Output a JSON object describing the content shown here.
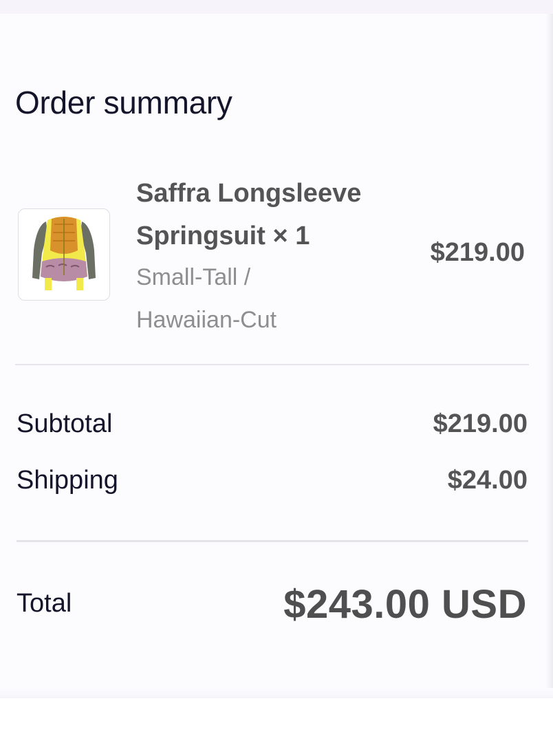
{
  "summary": {
    "title": "Order summary"
  },
  "line_item": {
    "name": "Saffra Longsleeve Springsuit × 1",
    "variant": "Small-Tall / Hawaiian-Cut",
    "price": "$219.00",
    "image_alt": "Saffra Longsleeve Springsuit product image"
  },
  "totals": {
    "subtotal_label": "Subtotal",
    "subtotal_value": "$219.00",
    "shipping_label": "Shipping",
    "shipping_value": "$24.00",
    "total_label": "Total",
    "total_value": "$243.00 USD"
  }
}
